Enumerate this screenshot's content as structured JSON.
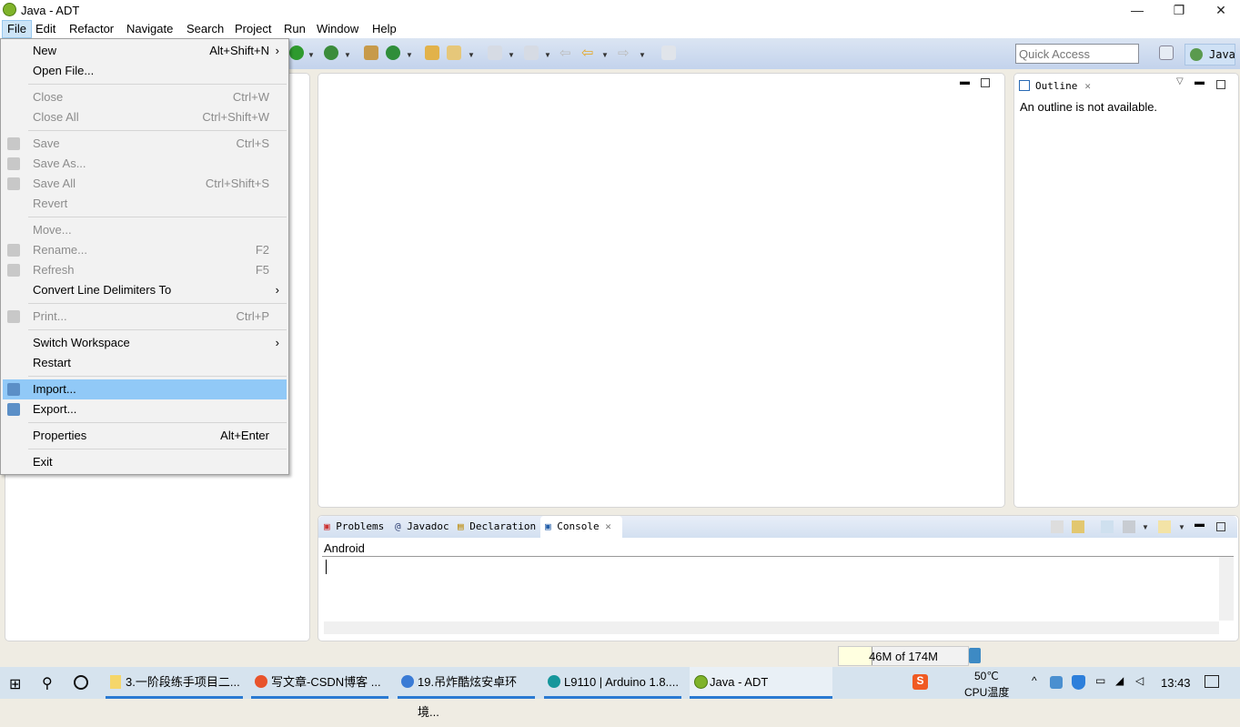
{
  "window": {
    "title": "Java - ADT",
    "controls": [
      "—",
      "❐",
      "✕"
    ]
  },
  "menubar": [
    "File",
    "Edit",
    "Refactor",
    "Navigate",
    "Search",
    "Project",
    "Run",
    "Window",
    "Help"
  ],
  "file_menu": [
    {
      "label": "New",
      "shortcut": "Alt+Shift+N",
      "submenu": true,
      "enabled": true
    },
    {
      "label": "Open File...",
      "shortcut": "",
      "enabled": true
    },
    {
      "sep": true
    },
    {
      "label": "Close",
      "shortcut": "Ctrl+W",
      "enabled": false
    },
    {
      "label": "Close All",
      "shortcut": "Ctrl+Shift+W",
      "enabled": false
    },
    {
      "sep": true
    },
    {
      "label": "Save",
      "shortcut": "Ctrl+S",
      "enabled": false,
      "icon": "save-icon"
    },
    {
      "label": "Save As...",
      "shortcut": "",
      "enabled": false,
      "icon": "save-as-icon"
    },
    {
      "label": "Save All",
      "shortcut": "Ctrl+Shift+S",
      "enabled": false,
      "icon": "save-all-icon"
    },
    {
      "label": "Revert",
      "shortcut": "",
      "enabled": false
    },
    {
      "sep": true
    },
    {
      "label": "Move...",
      "shortcut": "",
      "enabled": false
    },
    {
      "label": "Rename...",
      "shortcut": "F2",
      "enabled": false,
      "icon": "rename-icon"
    },
    {
      "label": "Refresh",
      "shortcut": "F5",
      "enabled": false,
      "icon": "refresh-icon"
    },
    {
      "label": "Convert Line Delimiters To",
      "shortcut": "",
      "submenu": true,
      "enabled": true
    },
    {
      "sep": true
    },
    {
      "label": "Print...",
      "shortcut": "Ctrl+P",
      "enabled": false,
      "icon": "print-icon"
    },
    {
      "sep": true
    },
    {
      "label": "Switch Workspace",
      "shortcut": "",
      "submenu": true,
      "enabled": true
    },
    {
      "label": "Restart",
      "shortcut": "",
      "enabled": true
    },
    {
      "sep": true
    },
    {
      "label": "Import...",
      "shortcut": "",
      "enabled": true,
      "highlighted": true,
      "icon": "import-icon"
    },
    {
      "label": "Export...",
      "shortcut": "",
      "enabled": true,
      "icon": "export-icon"
    },
    {
      "sep": true
    },
    {
      "label": "Properties",
      "shortcut": "Alt+Enter",
      "enabled": true
    },
    {
      "sep": true
    },
    {
      "label": "Exit",
      "shortcut": "",
      "enabled": true
    }
  ],
  "toolbar": {
    "quick_access_placeholder": "Quick Access",
    "perspective": "Java"
  },
  "outline": {
    "tab": "Outline",
    "message": "An outline is not available."
  },
  "bottom": {
    "tabs": [
      "Problems",
      "Javadoc",
      "Declaration",
      "Console"
    ],
    "active_tab": "Console",
    "console_title": "Android"
  },
  "status": {
    "memory": "46M of 174M",
    "memory_used_fraction": 0.26
  },
  "taskbar": {
    "tasks": [
      "3.一阶段练手项目二...",
      "写文章-CSDN博客 ...",
      "19.吊炸酷炫安卓环境...",
      "L9110 | Arduino 1.8....",
      "Java - ADT"
    ],
    "temp": "50℃",
    "temp_label": "CPU温度",
    "clock": "13:43"
  },
  "colors": {
    "highlight": "#91c9f7",
    "toolbar": "#c3d3ec",
    "taskbar": "#d6e3ee"
  }
}
